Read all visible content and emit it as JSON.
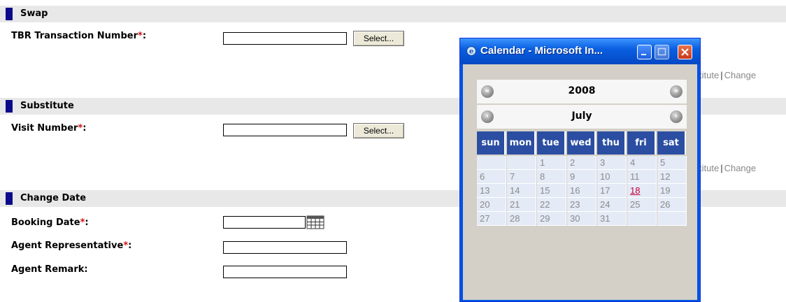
{
  "sections": {
    "swap": {
      "title": "Swap"
    },
    "substitute": {
      "title": "Substitute"
    },
    "change_date": {
      "title": "Change Date"
    }
  },
  "fields": {
    "tbr_transaction_number": {
      "label": "TBR Transaction Number",
      "required": "*",
      "suffix": ":",
      "value": "",
      "button": "Select..."
    },
    "visit_number": {
      "label": "Visit Number",
      "required": "*",
      "suffix": ":",
      "value": "",
      "button": "Select..."
    },
    "booking_date": {
      "label": "Booking Date",
      "required": "*",
      "suffix": ":",
      "value": ""
    },
    "agent_representative": {
      "label": "Agent Representative",
      "required": "*",
      "suffix": ":",
      "value": ""
    },
    "agent_remark": {
      "label": "Agent Remark:",
      "value": ""
    }
  },
  "side_links": {
    "row1": {
      "left": "titute",
      "sep": "|",
      "right": "Change"
    },
    "row2": {
      "left": "titute",
      "sep": "|",
      "right": "Change"
    }
  },
  "popup": {
    "title": "Calendar - Microsoft In...",
    "year": "2008",
    "month": "July",
    "weekdays": [
      "sun",
      "mon",
      "tue",
      "wed",
      "thu",
      "fri",
      "sat"
    ],
    "weeks": [
      [
        "",
        "",
        "1",
        "2",
        "3",
        "4",
        "5"
      ],
      [
        "6",
        "7",
        "8",
        "9",
        "10",
        "11",
        "12"
      ],
      [
        "13",
        "14",
        "15",
        "16",
        "17",
        "18",
        "19"
      ],
      [
        "20",
        "21",
        "22",
        "23",
        "24",
        "25",
        "26"
      ],
      [
        "27",
        "28",
        "29",
        "30",
        "31",
        "",
        ""
      ]
    ],
    "today": "18",
    "colors": {
      "header_bg": "#2b4ea2",
      "day_bg": "#e4eaf6",
      "today_text": "#c8003c",
      "required": "#d01010"
    }
  }
}
